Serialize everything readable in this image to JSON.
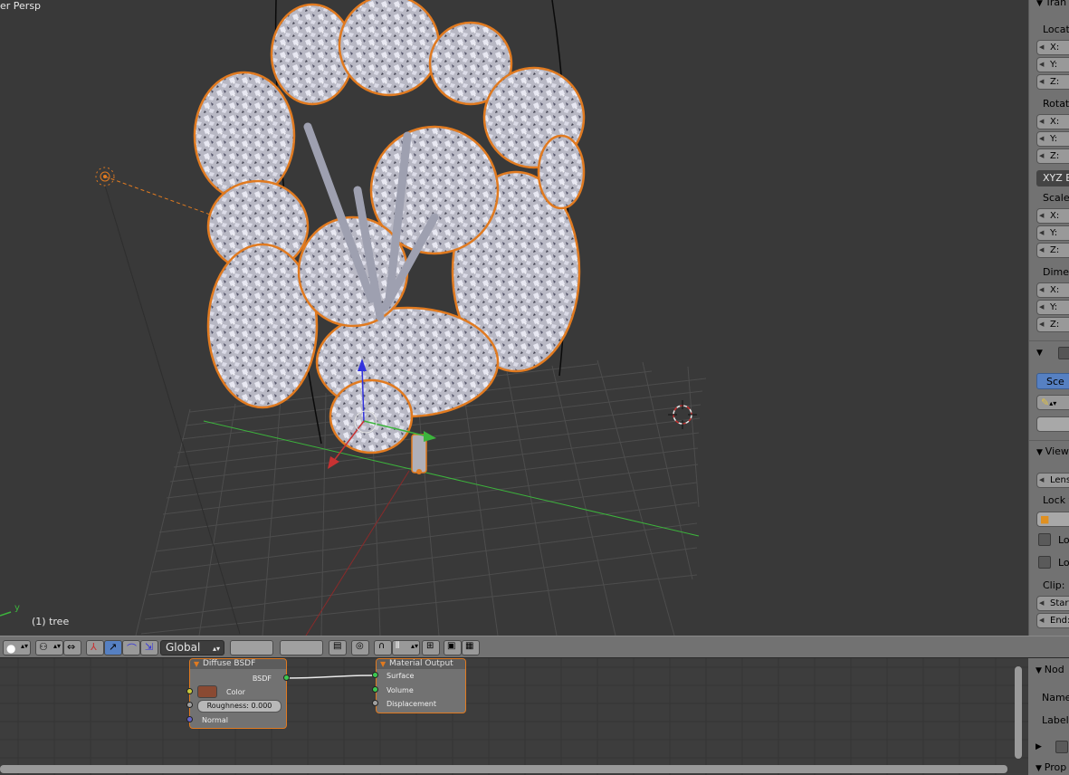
{
  "viewport": {
    "view_label": "er Persp",
    "object_label": "(1) tree",
    "axis_label": "y"
  },
  "properties_panel": {
    "transform_header": "Tran",
    "location_label": "Locati",
    "rotation_label": "Rotati",
    "scale_label": "Scale:",
    "dimensions_label": "Dimer",
    "x_label": "X:",
    "y_label": "Y:",
    "z_label": "Z:",
    "rotation_mode": "XYZ E",
    "scene_button": "Sce",
    "view_header": "View",
    "lens_label": "Lens",
    "lock_label": "Lock t",
    "lock_object_label": "Lo",
    "lock_cursor_label": "Lo",
    "clip_label": "Clip:",
    "clip_start": "Start",
    "clip_end": "End:"
  },
  "toolbar": {
    "orientation": "Global"
  },
  "nodes": {
    "diffuse": {
      "title": "Diffuse BSDF",
      "output": "BSDF",
      "color_label": "Color",
      "roughness": "Roughness:  0.000",
      "normal_label": "Normal",
      "color_swatch": "#8a4a33"
    },
    "material_output": {
      "title": "Material Output",
      "surface": "Surface",
      "volume": "Volume",
      "displacement": "Displacement"
    }
  },
  "node_panel": {
    "header": "Nod",
    "name_label": "Name",
    "label_label": "Label:",
    "properties_header": "Prop"
  },
  "colors": {
    "selection_outline": "#e07a20",
    "x_axis": "#c83232",
    "y_axis": "#3cb43c",
    "z_axis": "#3232dc",
    "active_blue": "#5680c2"
  }
}
